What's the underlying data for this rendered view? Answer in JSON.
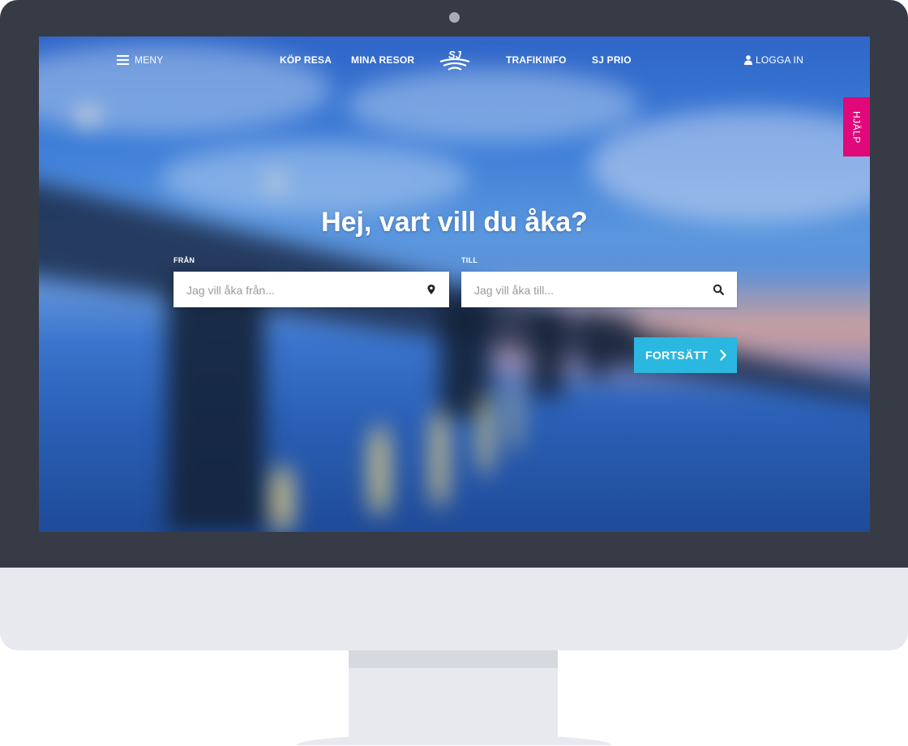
{
  "nav": {
    "menu_label": "MENY",
    "buy_trip": "KÖP RESA",
    "my_trips": "MINA RESOR",
    "logo_text": "SJ",
    "traffic_info": "TRAFIKINFO",
    "sj_prio": "SJ PRIO",
    "login": "LOGGA IN"
  },
  "help_tab": "HJÄLP",
  "hero": {
    "title": "Hej, vart vill du åka?",
    "from_label": "FRÅN",
    "from_placeholder": "Jag vill åka från...",
    "to_label": "TILL",
    "to_placeholder": "Jag vill åka till...",
    "continue_label": "FORTSÄTT"
  },
  "icons": {
    "menu": "hamburger-icon",
    "user": "user-icon",
    "from_field": "map-pin-icon",
    "to_field": "search-icon",
    "continue": "chevron-right-icon"
  },
  "colors": {
    "bezel": "#363b46",
    "help_accent": "#e0087a",
    "continue_button": "#2ab8e0"
  }
}
